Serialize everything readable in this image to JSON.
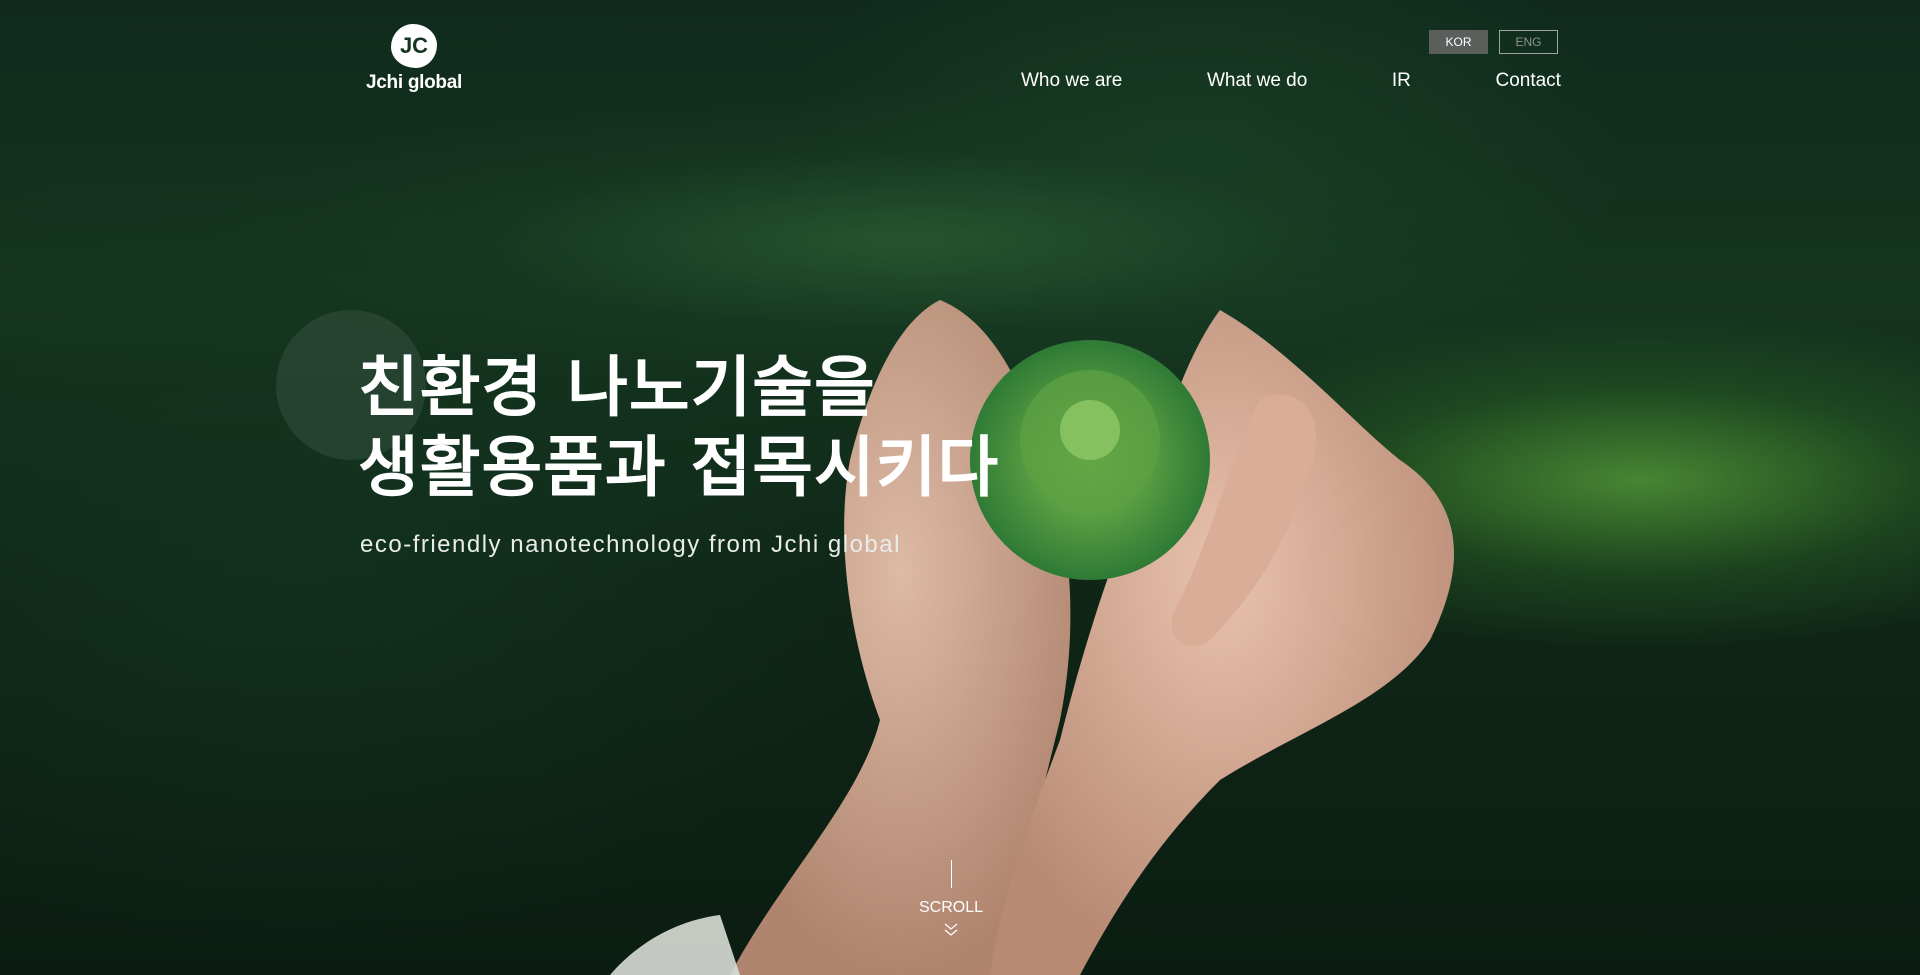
{
  "header": {
    "logo_text": "Jchi global",
    "logo_mark": "JC",
    "lang": {
      "kor": "KOR",
      "eng": "ENG",
      "active": "KOR"
    },
    "nav": [
      {
        "label": "Who we are"
      },
      {
        "label": "What we do"
      },
      {
        "label": "IR"
      },
      {
        "label": "Contact"
      }
    ]
  },
  "hero": {
    "headline_line1": "친환경 나노기술을",
    "headline_line2": "생활용품과 접목시키다",
    "subline": "eco-friendly nanotechnology from Jchi global"
  },
  "scroll": {
    "label": "SCROLL",
    "icon": "double-chevron-down-icon"
  },
  "colors": {
    "bg_dark": "#0f2a1d",
    "leaf_green": "#4f9a3a",
    "lang_active_bg": "#5b5f5c"
  }
}
